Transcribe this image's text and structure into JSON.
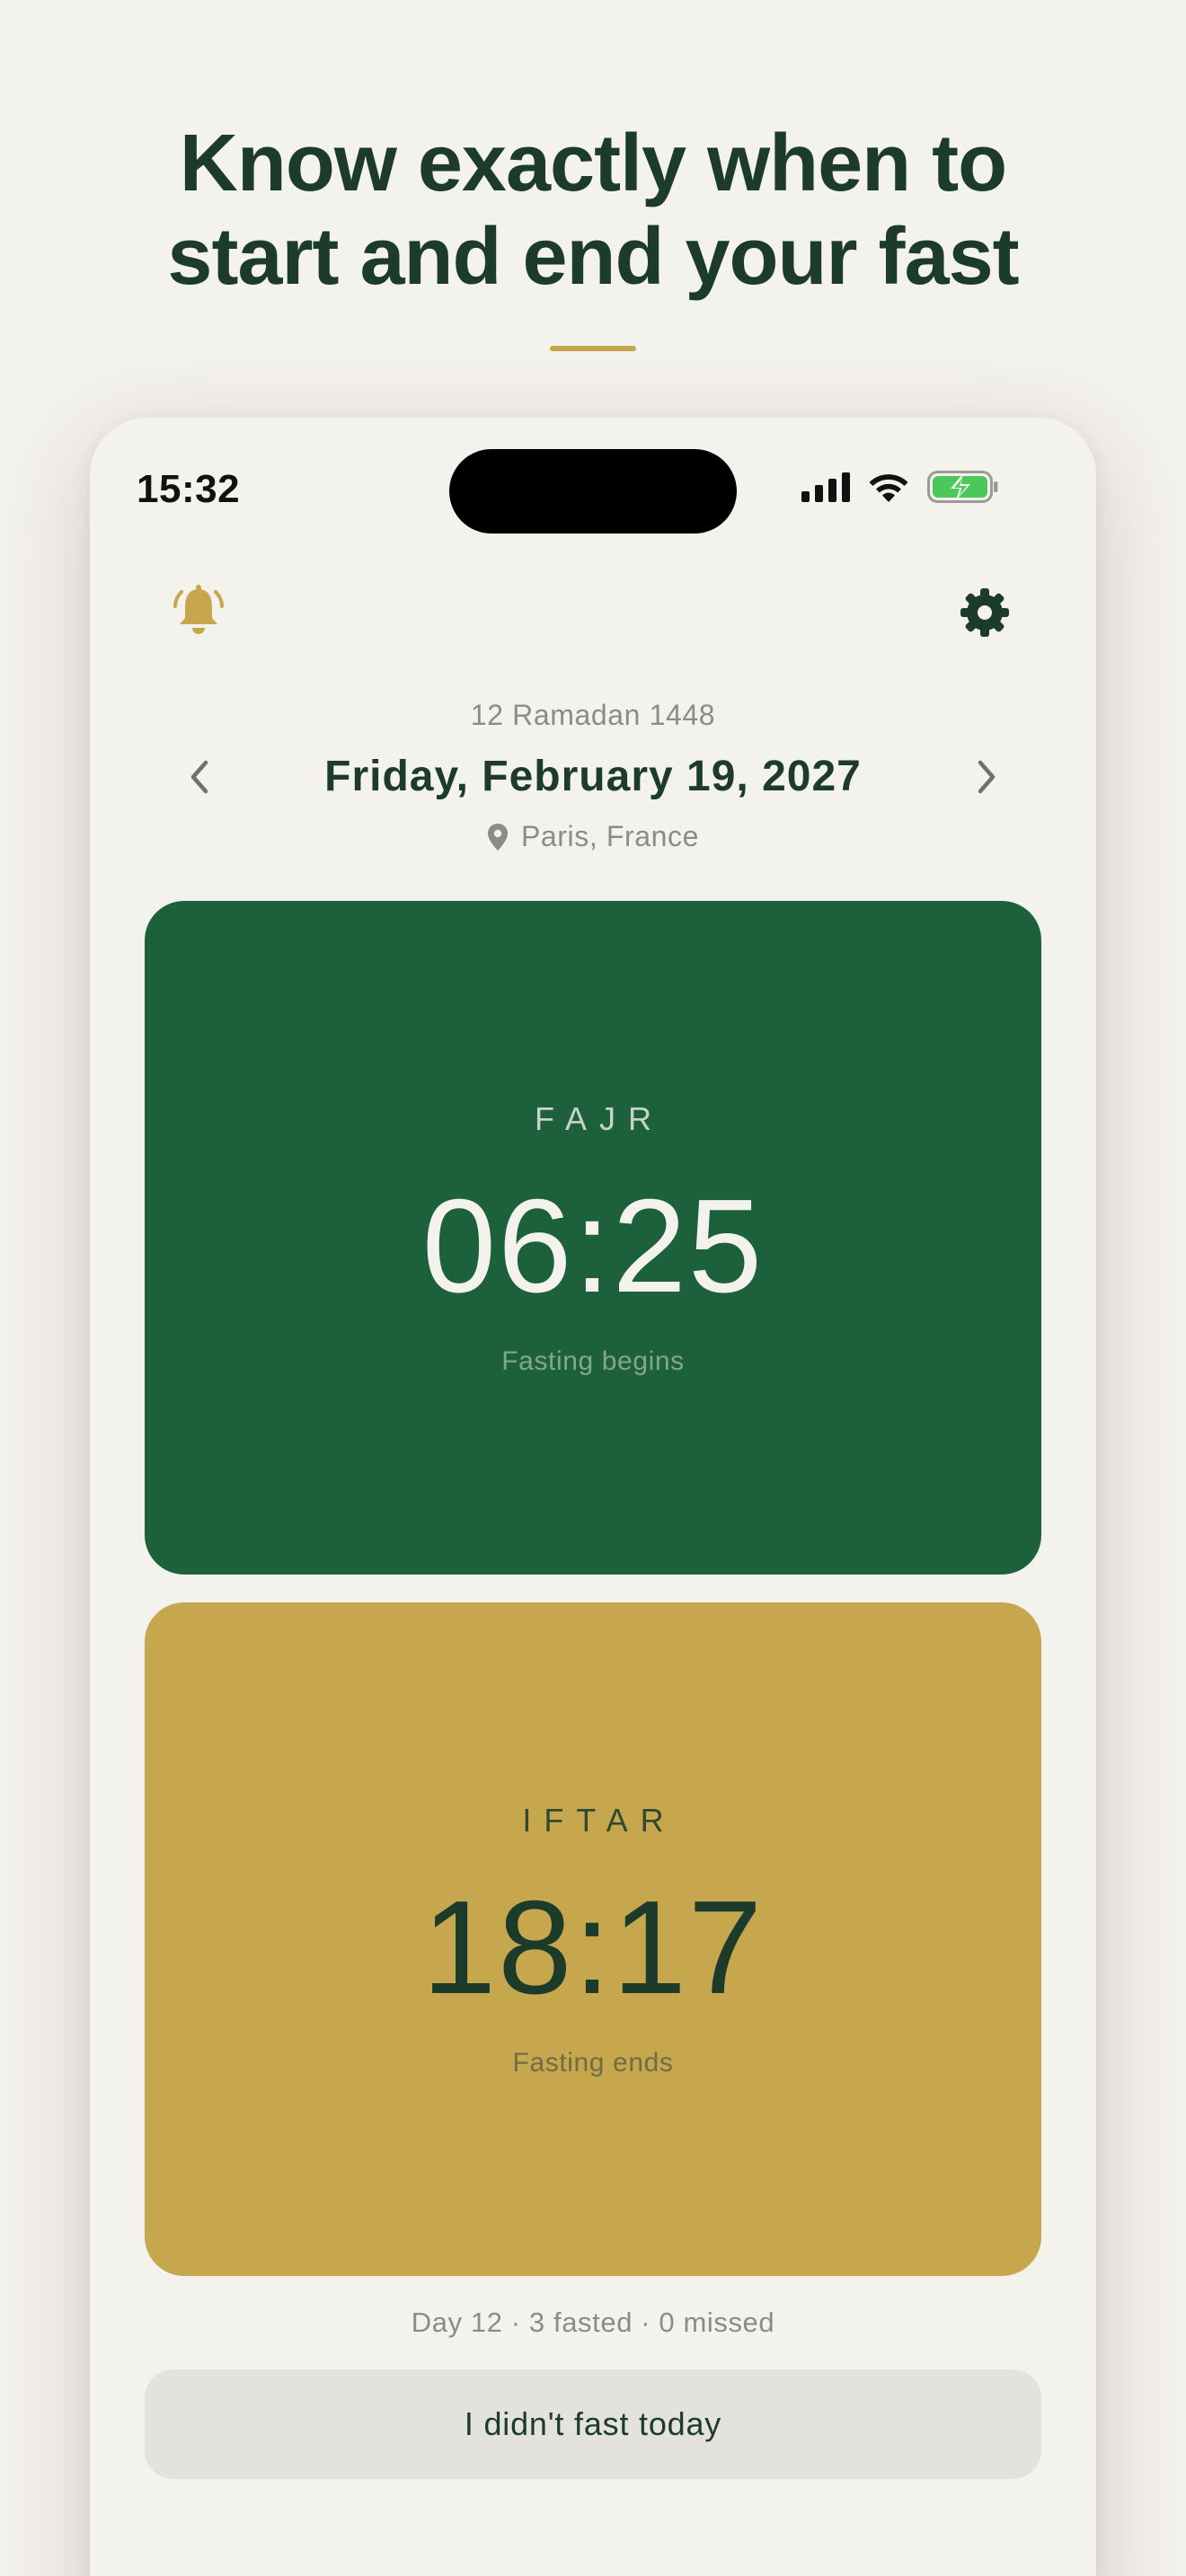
{
  "headline": {
    "line1": "Know exactly when to",
    "line2": "start and end your fast"
  },
  "status_bar": {
    "time": "15:32",
    "icons": [
      "cellular-signal-icon",
      "wifi-icon",
      "battery-charging-icon"
    ]
  },
  "toolbar": {
    "left_icon": "bell-icon",
    "right_icon": "gear-icon"
  },
  "date_header": {
    "hijri_date": "12 Ramadan 1448",
    "gregorian_date": "Friday, February 19, 2027",
    "location": "Paris, France"
  },
  "fajr_card": {
    "label": "FAJR",
    "time": "06:25",
    "subtitle": "Fasting begins"
  },
  "iftar_card": {
    "label": "IFTAR",
    "time": "18:17",
    "subtitle": "Fasting ends"
  },
  "stats": {
    "summary": "Day 12 · 3 fasted · 0 missed"
  },
  "missed_button": {
    "label": "I didn't fast today"
  },
  "colors": {
    "background": "#f4f2ec",
    "deep_green": "#1c603c",
    "dark_text": "#1c3b2a",
    "gold": "#c7a74e",
    "muted_text": "#8a8d86",
    "button_bg": "#e3e2dd",
    "battery_green": "#4cc75a"
  }
}
